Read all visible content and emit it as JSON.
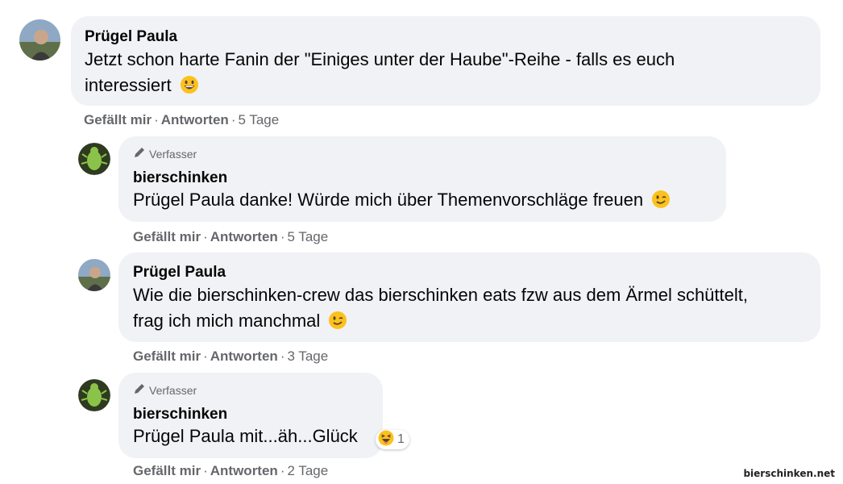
{
  "comments": [
    {
      "author": "Prügel Paula",
      "text": "Jetzt schon harte Fanin der \"Einiges unter der Haube\"-Reihe - falls es euch interessiert",
      "text_line1": "Jetzt schon harte Fanin der \"Einiges unter der Haube\"-Reihe - falls es euch",
      "text_line2": "interessiert",
      "emoji": "grinning-face-icon",
      "like": "Gefällt mir",
      "reply": "Antworten",
      "age": "5 Tage"
    },
    {
      "badge": "Verfasser",
      "author": "bierschinken",
      "mention": "Prügel Paula",
      "text": " danke! Würde mich über Themenvorschläge freuen",
      "emoji": "winking-face-icon",
      "like": "Gefällt mir",
      "reply": "Antworten",
      "age": "5 Tage"
    },
    {
      "author": "Prügel Paula",
      "text_line1": "Wie die bierschinken-crew das bierschinken eats fzw aus dem Ärmel schüttelt,",
      "text_line2": "frag ich mich manchmal",
      "emoji": "winking-face-icon",
      "like": "Gefällt mir",
      "reply": "Antworten",
      "age": "3 Tage"
    },
    {
      "badge": "Verfasser",
      "author": "bierschinken",
      "mention": "Prügel Paula",
      "text": " mit...äh...Glück",
      "reaction": {
        "icon": "laughing-face-icon",
        "count": "1"
      },
      "like": "Gefällt mir",
      "reply": "Antworten",
      "age": "2 Tage"
    }
  ],
  "separator": "·",
  "watermark": "bierschinken.net",
  "colors": {
    "bubble": "#f0f2f5",
    "meta": "#65676b",
    "text": "#050505"
  }
}
